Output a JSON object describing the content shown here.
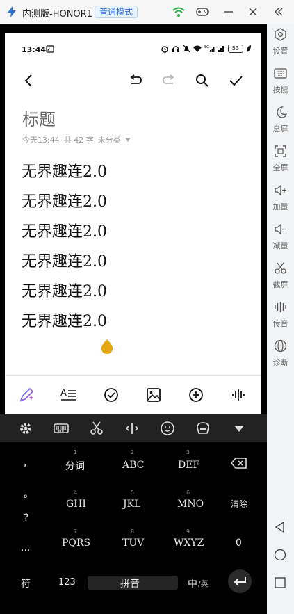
{
  "titlebar": {
    "title": "内测版-HONOR1",
    "mode_badge": "普通模式"
  },
  "status": {
    "time": "13:44",
    "battery": "53"
  },
  "note": {
    "title_placeholder": "标题",
    "meta_time": "今天13:44",
    "meta_count": "共 42 字",
    "meta_category": "未分类",
    "lines": [
      "无界趣连2.0",
      "无界趣连2.0",
      "无界趣连2.0",
      "无界趣连2.0",
      "无界趣连2.0",
      "无界趣连2.0"
    ]
  },
  "keyboard": {
    "keys": [
      {
        "num": "1",
        "label": "分词"
      },
      {
        "num": "2",
        "label": "ABC"
      },
      {
        "num": "3",
        "label": "DEF"
      },
      {
        "num": "4",
        "label": "GHI"
      },
      {
        "num": "5",
        "label": "JKL"
      },
      {
        "num": "6",
        "label": "MNO"
      },
      {
        "num": "7",
        "label": "PQRS"
      },
      {
        "num": "8",
        "label": "TUV"
      },
      {
        "num": "9",
        "label": "WXYZ"
      }
    ],
    "side": [
      ",",
      "。",
      "?",
      "..."
    ],
    "clear": "清除",
    "zero": "0",
    "symbol": "符",
    "num123": "123",
    "space": "拼音",
    "lang_zh": "中",
    "lang_en": "/英"
  },
  "sidebar": {
    "items": [
      "设置",
      "按键",
      "息屏",
      "全屏",
      "加量",
      "减量",
      "截屏",
      "传音",
      "诊断"
    ]
  },
  "colors": {
    "accent": "#2f6fd6",
    "cursor": "#e5a711",
    "wifi": "#2bb24c"
  }
}
